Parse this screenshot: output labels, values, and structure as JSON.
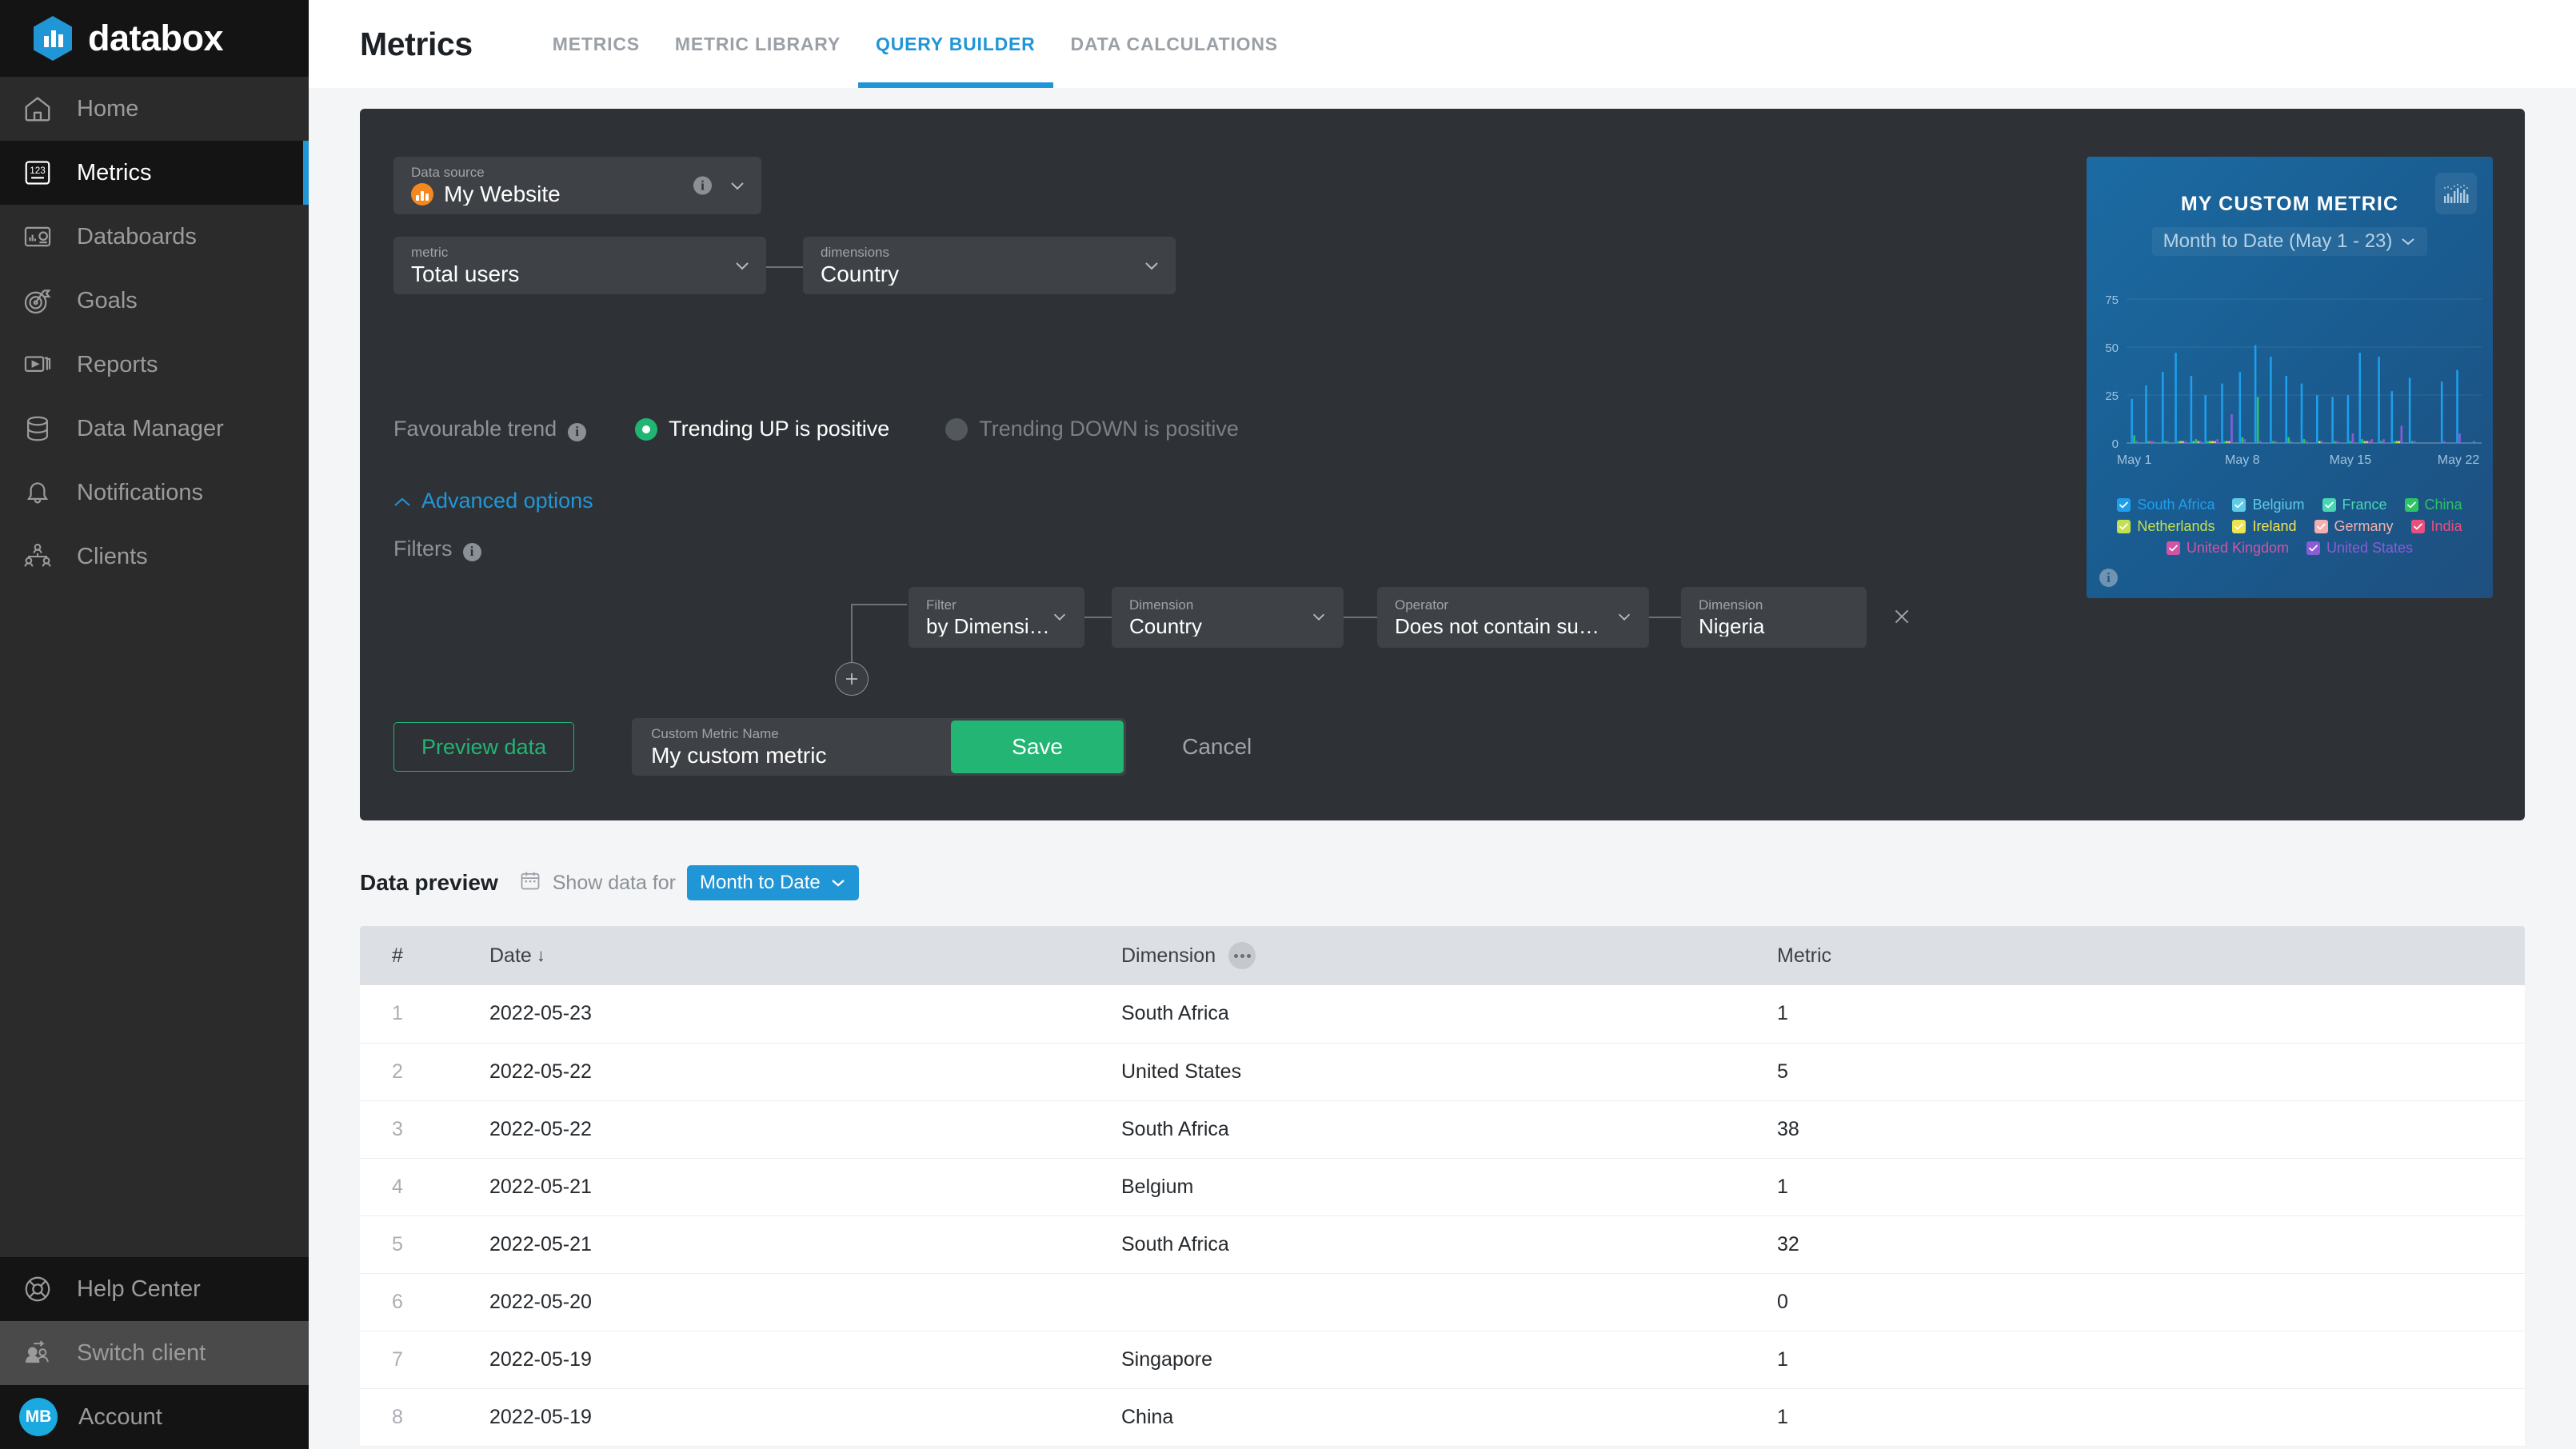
{
  "brand": {
    "name": "databox",
    "accent": "#2196d6"
  },
  "sidebar": {
    "items": [
      {
        "label": "Home",
        "icon": "home-icon"
      },
      {
        "label": "Metrics",
        "icon": "numbers-123-icon",
        "active": true
      },
      {
        "label": "Databoards",
        "icon": "databoard-icon"
      },
      {
        "label": "Goals",
        "icon": "target-flag-icon"
      },
      {
        "label": "Reports",
        "icon": "report-play-icon"
      },
      {
        "label": "Data Manager",
        "icon": "database-icon"
      },
      {
        "label": "Notifications",
        "icon": "bell-icon"
      },
      {
        "label": "Clients",
        "icon": "users-group-icon"
      }
    ],
    "bottom": [
      {
        "label": "Help Center",
        "icon": "lifebuoy-icon"
      },
      {
        "label": "Switch client",
        "icon": "switch-user-icon"
      }
    ],
    "account": {
      "label": "Account",
      "initials": "MB"
    }
  },
  "header": {
    "title": "Metrics",
    "tabs": [
      {
        "label": "METRICS",
        "active": false
      },
      {
        "label": "METRIC LIBRARY",
        "active": false
      },
      {
        "label": "QUERY BUILDER",
        "active": true
      },
      {
        "label": "DATA CALCULATIONS",
        "active": false
      }
    ]
  },
  "builder": {
    "data_source": {
      "label": "Data source",
      "value": "My Website",
      "icon": "analytics-orange-icon"
    },
    "metric": {
      "label": "metric",
      "value": "Total users"
    },
    "dimensions": {
      "label": "dimensions",
      "value": "Country"
    },
    "favourable_trend": {
      "label": "Favourable trend",
      "option_up": "Trending UP is positive",
      "option_down": "Trending DOWN is positive",
      "selected": "up"
    },
    "advanced_options": "Advanced options",
    "filters_label": "Filters",
    "filter_row": {
      "filter": {
        "label": "Filter",
        "value": "by Dimensio..."
      },
      "dimension": {
        "label": "Dimension",
        "value": "Country"
      },
      "operator": {
        "label": "Operator",
        "value": "Does not contain substr..."
      },
      "dimension_value": {
        "label": "Dimension",
        "value": "Nigeria"
      }
    },
    "actions": {
      "preview": "Preview data",
      "name_label": "Custom Metric Name",
      "name_value": "My custom metric",
      "save": "Save",
      "cancel": "Cancel"
    }
  },
  "data_preview": {
    "title": "Data preview",
    "show_data_for_label": "Show data for",
    "range": "Month to Date",
    "columns": [
      "#",
      "Date",
      "Dimension",
      "Metric"
    ],
    "sorted_column": "Date",
    "sort_direction": "desc",
    "rows": [
      {
        "idx": "1",
        "date": "2022-05-23",
        "dimension": "South Africa",
        "metric": "1"
      },
      {
        "idx": "2",
        "date": "2022-05-22",
        "dimension": "United States",
        "metric": "5"
      },
      {
        "idx": "3",
        "date": "2022-05-22",
        "dimension": "South Africa",
        "metric": "38"
      },
      {
        "idx": "4",
        "date": "2022-05-21",
        "dimension": "Belgium",
        "metric": "1"
      },
      {
        "idx": "5",
        "date": "2022-05-21",
        "dimension": "South Africa",
        "metric": "32"
      },
      {
        "idx": "6",
        "date": "2022-05-20",
        "dimension": "",
        "metric": "0"
      },
      {
        "idx": "7",
        "date": "2022-05-19",
        "dimension": "Singapore",
        "metric": "1"
      },
      {
        "idx": "8",
        "date": "2022-05-19",
        "dimension": "China",
        "metric": "1"
      }
    ]
  },
  "chart_data": {
    "type": "bar",
    "title": "MY CUSTOM METRIC",
    "subtitle": "Month to Date (May 1 - 23)",
    "xlabel": "",
    "ylabel": "",
    "ylim": [
      0,
      75
    ],
    "yticks": [
      0,
      25,
      50,
      75
    ],
    "grid": true,
    "legend_position": "bottom",
    "x": [
      "May 1",
      "May 2",
      "May 3",
      "May 4",
      "May 5",
      "May 6",
      "May 7",
      "May 8",
      "May 9",
      "May 10",
      "May 11",
      "May 12",
      "May 13",
      "May 14",
      "May 15",
      "May 16",
      "May 17",
      "May 18",
      "May 19",
      "May 20",
      "May 21",
      "May 22",
      "May 23"
    ],
    "xtick_labels": [
      "May 1",
      "May 8",
      "May 15",
      "May 22"
    ],
    "series": [
      {
        "name": "South Africa",
        "color": "#1e9eeb",
        "values": [
          23,
          30,
          37,
          47,
          35,
          25,
          31,
          37,
          51,
          45,
          35,
          31,
          25,
          24,
          25,
          47,
          45,
          27,
          34,
          0,
          32,
          38,
          1
        ]
      },
      {
        "name": "Belgium",
        "color": "#5ecbe8",
        "values": [
          0,
          0,
          0,
          0,
          0,
          0,
          0,
          0,
          0,
          0,
          0,
          0,
          0,
          0,
          0,
          0,
          0,
          0,
          0,
          0,
          0,
          0,
          0
        ]
      },
      {
        "name": "France",
        "color": "#49d6b4",
        "values": [
          0,
          0,
          0,
          0,
          1,
          0,
          0,
          0,
          0,
          0,
          0,
          0,
          0,
          0,
          0,
          0,
          0,
          0,
          0,
          0,
          0,
          0,
          0
        ]
      },
      {
        "name": "China",
        "color": "#2bc562",
        "values": [
          4,
          1,
          1,
          1,
          2,
          1,
          1,
          3,
          24,
          1,
          3,
          2,
          0,
          1,
          1,
          2,
          1,
          1,
          1,
          0,
          0,
          0,
          0
        ]
      },
      {
        "name": "Netherlands",
        "color": "#c2e04f",
        "values": [
          0,
          0,
          0,
          1,
          0,
          1,
          1,
          0,
          0,
          0,
          0,
          0,
          1,
          0,
          0,
          1,
          0,
          1,
          0,
          0,
          0,
          0,
          0
        ]
      },
      {
        "name": "Ireland",
        "color": "#f0e44e",
        "values": [
          0,
          0,
          0,
          0,
          0,
          1,
          0,
          0,
          0,
          0,
          0,
          0,
          0,
          0,
          0,
          0,
          0,
          1,
          0,
          0,
          0,
          0,
          0
        ]
      },
      {
        "name": "Germany",
        "color": "#f3afae",
        "values": [
          0,
          0,
          0,
          1,
          1,
          1,
          1,
          0,
          0,
          0,
          0,
          0,
          0,
          0,
          0,
          1,
          0,
          0,
          0,
          0,
          0,
          0,
          0
        ]
      },
      {
        "name": "India",
        "color": "#ea4f7c",
        "values": [
          0,
          1,
          0,
          0,
          0,
          0,
          0,
          0,
          0,
          0,
          0,
          0,
          0,
          0,
          0,
          0,
          0,
          0,
          0,
          0,
          0,
          0,
          0
        ]
      },
      {
        "name": "United Kingdom",
        "color": "#d353a6",
        "values": [
          0,
          0,
          0,
          0,
          0,
          0,
          0,
          0,
          0,
          0,
          0,
          0,
          0,
          0,
          0,
          1,
          0,
          0,
          0,
          0,
          0,
          0,
          0
        ]
      },
      {
        "name": "United States",
        "color": "#8b5cd6",
        "values": [
          1,
          1,
          1,
          1,
          1,
          2,
          15,
          2,
          1,
          1,
          1,
          1,
          1,
          1,
          5,
          2,
          2,
          9,
          1,
          0,
          1,
          5,
          0
        ]
      }
    ]
  }
}
